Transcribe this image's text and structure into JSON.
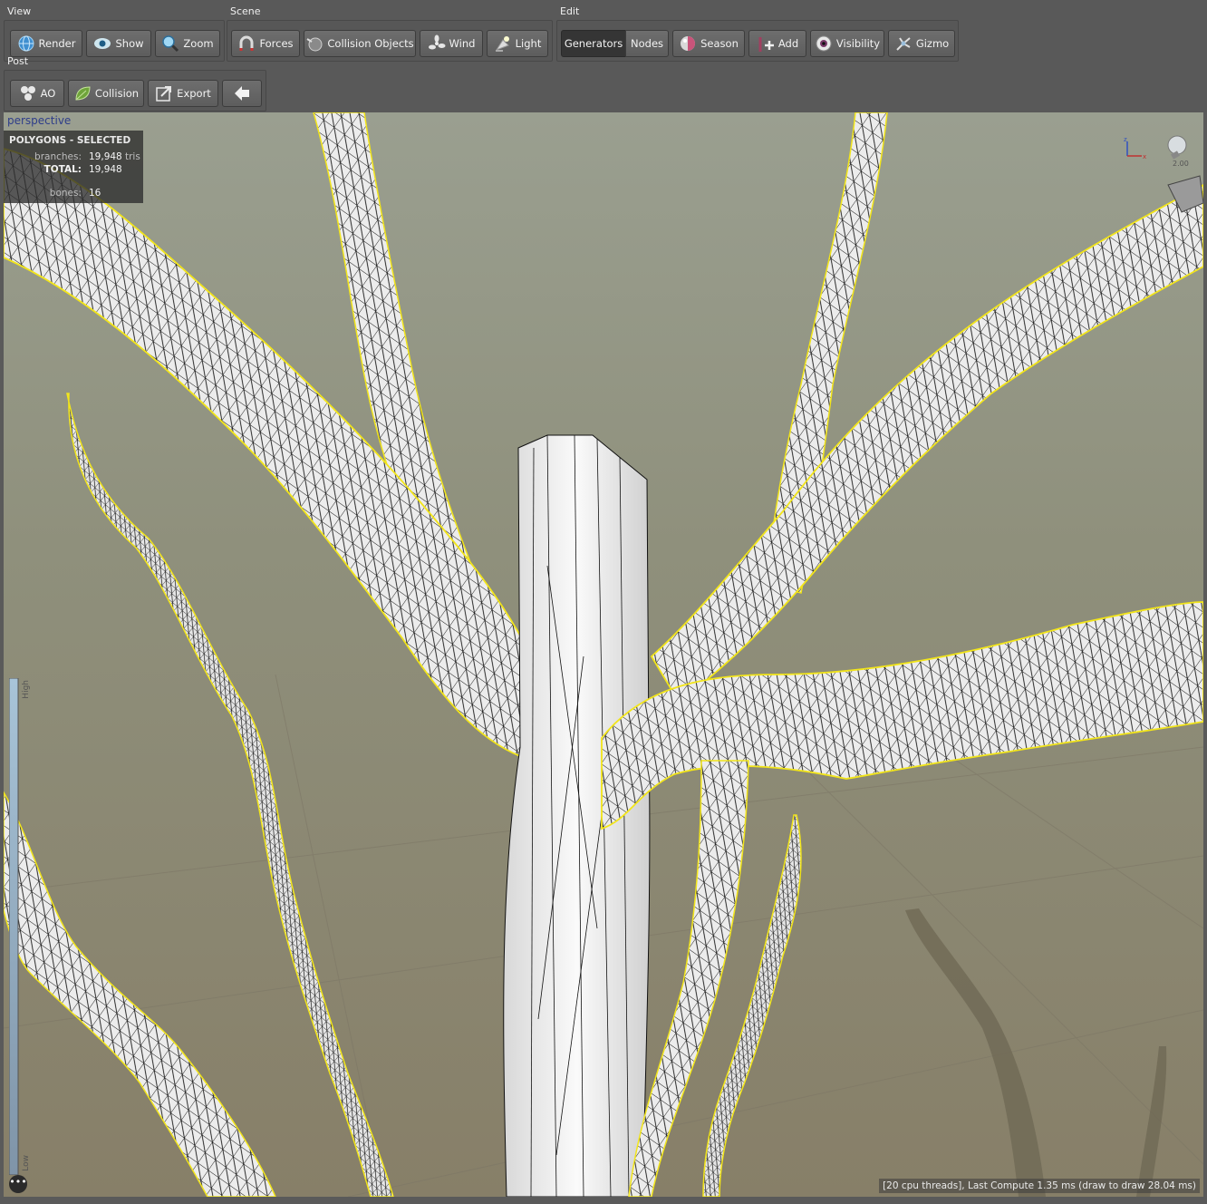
{
  "groups": {
    "view": {
      "label": "View",
      "buttons": [
        {
          "label": "Render",
          "icon": "globe-icon"
        },
        {
          "label": "Show",
          "icon": "eye-icon"
        },
        {
          "label": "Zoom",
          "icon": "magnifier-icon"
        }
      ]
    },
    "scene": {
      "label": "Scene",
      "buttons": [
        {
          "label": "Forces",
          "icon": "magnet-icon"
        },
        {
          "label": "Collision Objects",
          "icon": "collision-sphere-icon"
        },
        {
          "label": "Wind",
          "icon": "fan-icon"
        },
        {
          "label": "Light",
          "icon": "lamp-icon"
        }
      ]
    },
    "edit": {
      "label": "Edit",
      "buttons": [
        {
          "label": "Generators",
          "icon": "",
          "active": true
        },
        {
          "label": "Nodes",
          "icon": ""
        },
        {
          "label": "Season",
          "icon": "season-icon"
        },
        {
          "label": "Add",
          "icon": "add-branch-icon"
        },
        {
          "label": "Visibility",
          "icon": "eyeball-icon"
        },
        {
          "label": "Gizmo",
          "icon": "gizmo-icon"
        }
      ]
    },
    "post": {
      "label": "Post",
      "buttons": [
        {
          "label": "AO",
          "icon": "ao-spheres-icon"
        },
        {
          "label": "Collision",
          "icon": "leaf-icon"
        },
        {
          "label": "Export",
          "icon": "export-icon"
        },
        {
          "label": "",
          "icon": "back-arrow-icon"
        }
      ]
    }
  },
  "viewport": {
    "camera_label": "perspective",
    "stats": {
      "title": "POLYGONS - SELECTED",
      "branches_label": "branches:",
      "branches_value": "19,948",
      "branches_unit": "tris",
      "total_label": "TOTAL:",
      "total_value": "19,948",
      "bones_label": "bones:",
      "bones_value": "16"
    },
    "scale_high": "High",
    "scale_low": "Low",
    "light_value": "2.00",
    "more_label": "•••",
    "status_text": "[20 cpu threads], Last Compute 1.35 ms (draw to draw 28.04 ms)"
  },
  "colors": {
    "selection_outline": "#f2e51a",
    "mesh_fill": "#ececec",
    "wire": "#111111",
    "toolbar_bg": "#595959"
  }
}
